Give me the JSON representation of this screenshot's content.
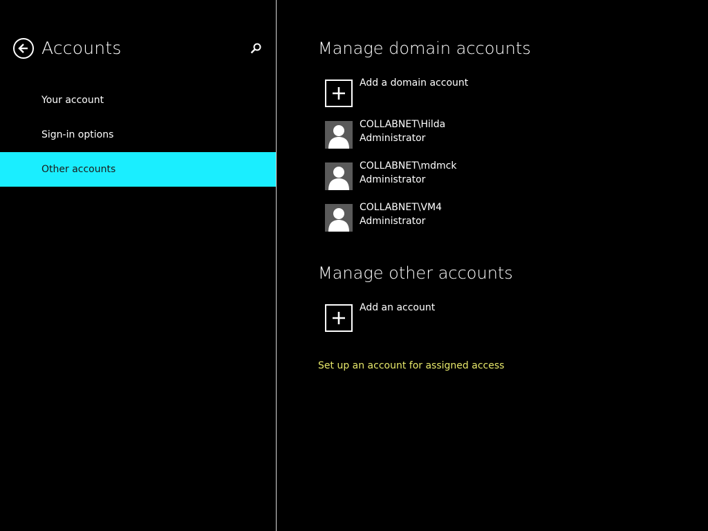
{
  "nav": {
    "title": "Accounts",
    "items": [
      {
        "label": "Your account",
        "selected": false
      },
      {
        "label": "Sign-in options",
        "selected": false
      },
      {
        "label": "Other accounts",
        "selected": true
      }
    ]
  },
  "icons": {
    "back": "back-arrow-icon",
    "search": "search-icon",
    "add": "plus-icon",
    "user": "user-avatar-icon"
  },
  "colors": {
    "accent": "#1aeeff",
    "link": "#e7e86a",
    "background": "#000000",
    "avatar_bg": "#5a5a5a"
  },
  "main": {
    "domain_section": {
      "title": "Manage domain accounts",
      "add_label": "Add a domain account",
      "accounts": [
        {
          "name": "COLLABNET\\Hilda",
          "role": "Administrator"
        },
        {
          "name": "COLLABNET\\mdmck",
          "role": "Administrator"
        },
        {
          "name": "COLLABNET\\VM4",
          "role": "Administrator"
        }
      ]
    },
    "other_section": {
      "title": "Manage other accounts",
      "add_label": "Add an account"
    },
    "assigned_access_link": "Set up an account for assigned access"
  }
}
